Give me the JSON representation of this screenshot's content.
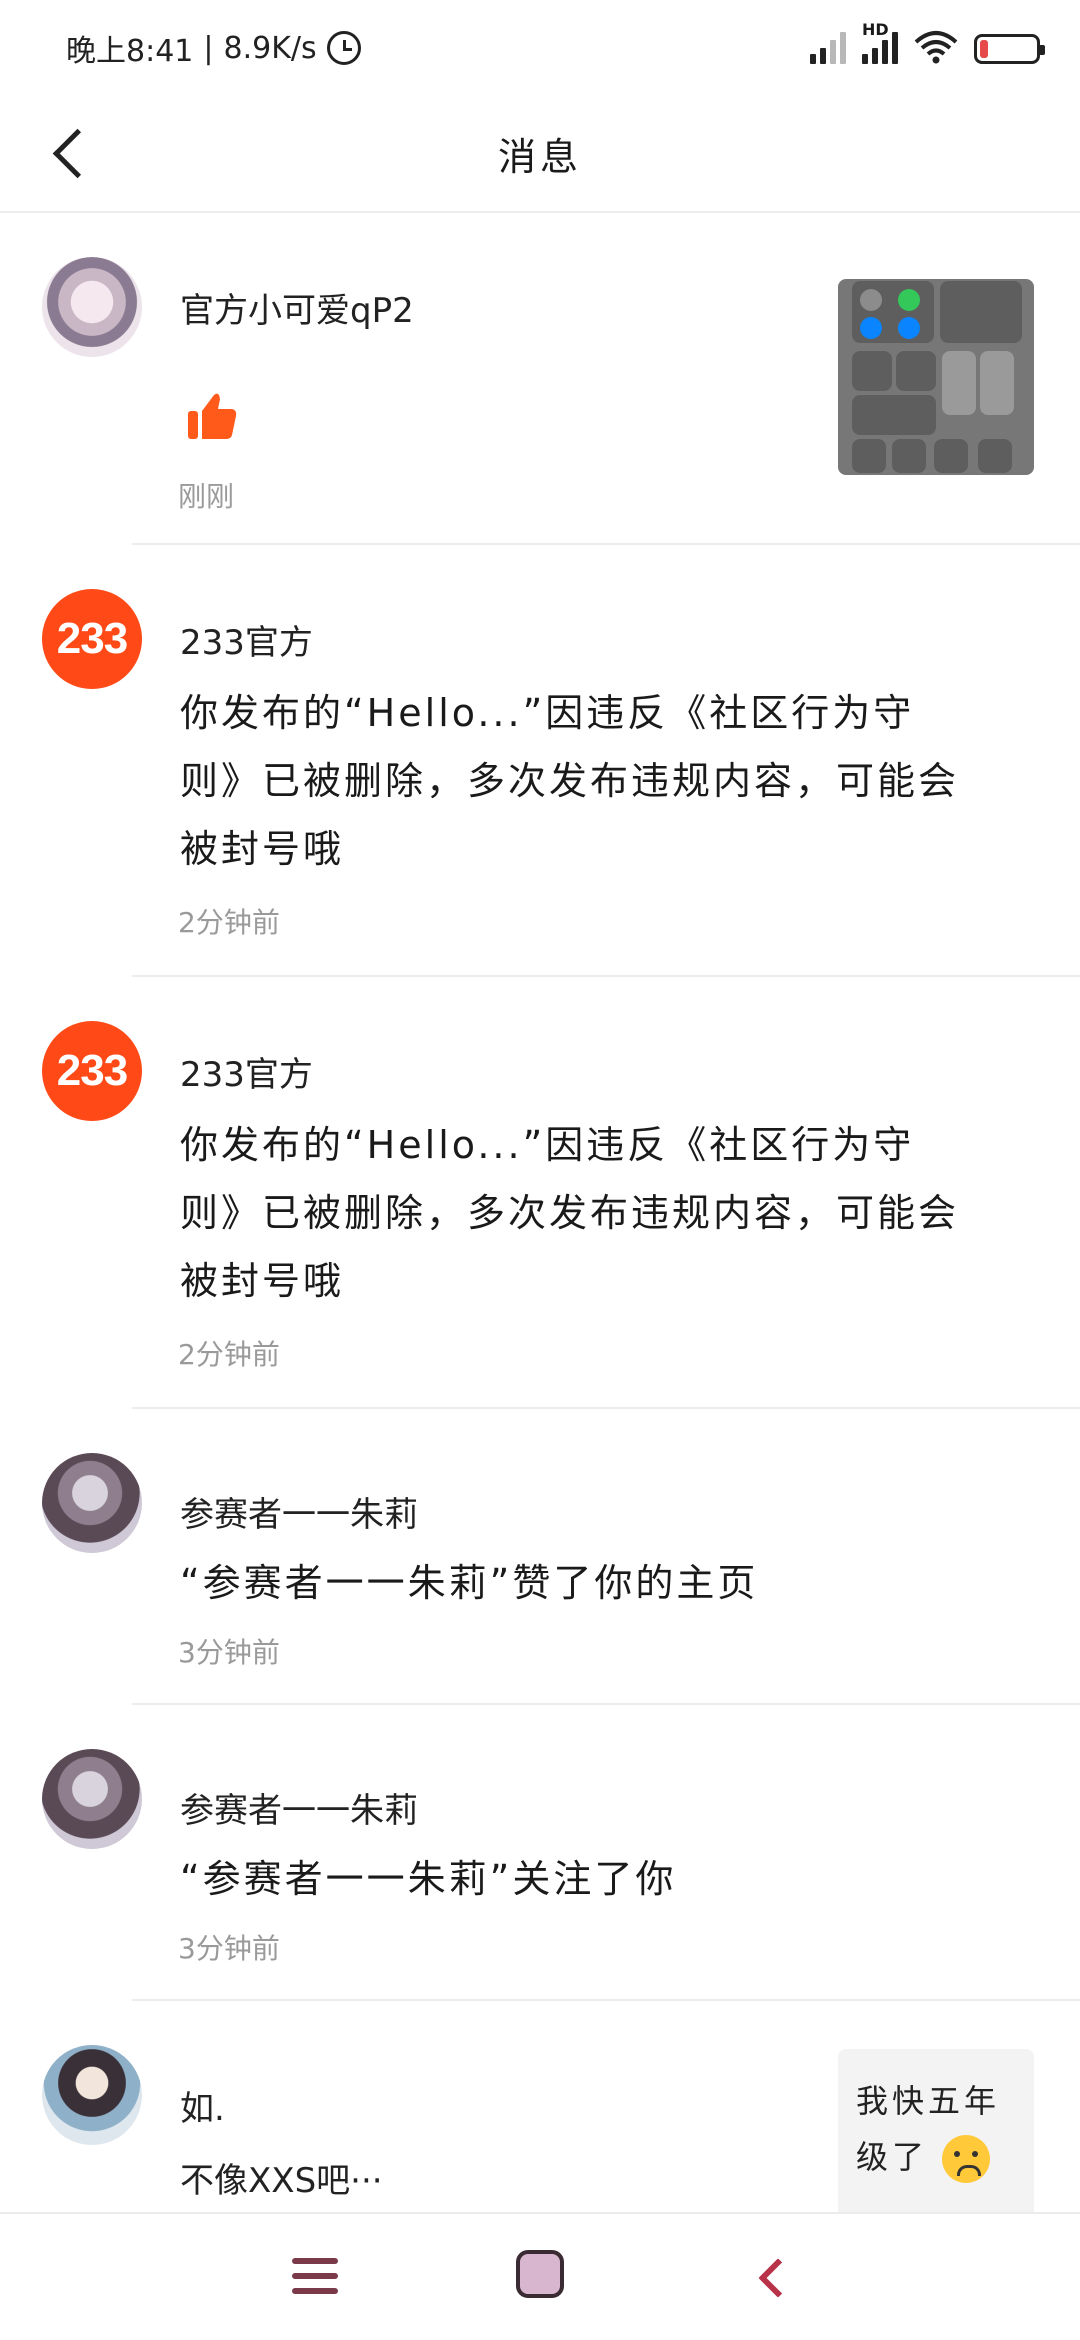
{
  "status_bar": {
    "time": "晚上8:41",
    "net_speed": "8.9K/s",
    "network_label": "HD",
    "battery_level": 0.15
  },
  "header": {
    "back_icon": "back-arrow-icon",
    "title": "消息"
  },
  "messages": [
    {
      "name": "官方小可爱qP2",
      "avatar": "anime-girl-avatar",
      "content_icon": "thumbs-up-icon",
      "time": "刚刚",
      "preview_type": "control-center-screenshot"
    },
    {
      "name": "233官方",
      "avatar_text": "233",
      "text": "你发布的“Hello...”因违反《社区行为守则》已被删除，多次发布违规内容，可能会被封号哦",
      "time": "2分钟前"
    },
    {
      "name": "233官方",
      "avatar_text": "233",
      "text": "你发布的“Hello...”因违反《社区行为守则》已被删除，多次发布违规内容，可能会被封号哦",
      "time": "2分钟前"
    },
    {
      "name": "参赛者一一朱莉",
      "text": "“参赛者一一朱莉”赞了你的主页",
      "time": "3分钟前"
    },
    {
      "name": "参赛者一一朱莉",
      "text": "“参赛者一一朱莉”关注了你",
      "time": "3分钟前"
    },
    {
      "name": "如.",
      "text": "不像XXS吧···",
      "preview_text": "我快五年级了"
    }
  ],
  "navbar": {
    "menu_icon": "menu-icon",
    "home_icon": "home-icon",
    "back_icon": "back-icon"
  },
  "colors": {
    "brand_orange": "#ff4a17",
    "thumb_orange": "#ff5a1a"
  }
}
